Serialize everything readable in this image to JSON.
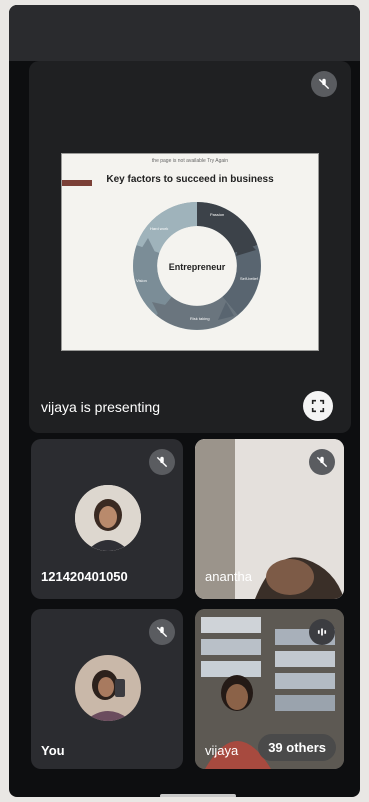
{
  "slide": {
    "header_text": "the page is not available   Try Again",
    "title": "Key factors to succeed in business",
    "center_label": "Entrepreneur",
    "segment_labels": [
      "Passion",
      "Self-belief",
      "Risk taking",
      "Vision",
      "Hard work"
    ]
  },
  "presenting": {
    "label": "vijaya is presenting"
  },
  "tiles": {
    "participant1": {
      "name": "121420401050"
    },
    "participant2": {
      "name": "ananthа"
    },
    "you": {
      "name": "You"
    },
    "vijaya": {
      "name": "vijaya",
      "others_label": "39 others"
    }
  },
  "icons": {
    "mic_off": "mic-off-icon",
    "fullscreen": "fullscreen-icon",
    "speaking": "audio-wave-icon"
  },
  "colors": {
    "background": "#0d0e10",
    "tile": "#2b2c30",
    "mic_badge": "#5a5c60"
  }
}
